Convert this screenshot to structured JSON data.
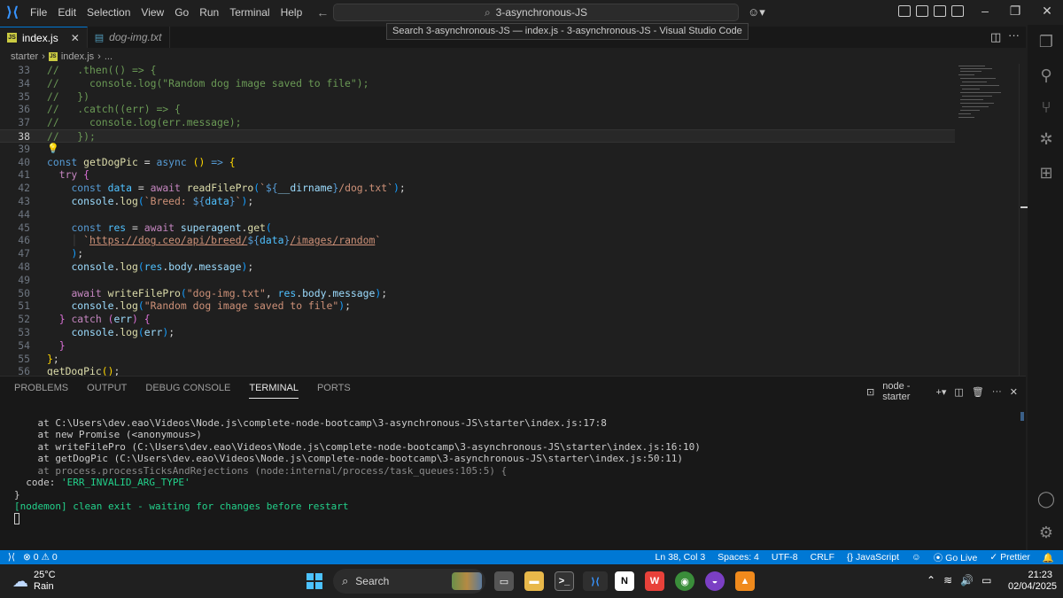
{
  "titlebar": {
    "menu": [
      "File",
      "Edit",
      "Selection",
      "View",
      "Go",
      "Run",
      "Terminal",
      "Help"
    ],
    "command_center": "3-asynchronous-JS",
    "tooltip": "Search 3-asynchronous-JS — index.js - 3-asynchronous-JS - Visual Studio Code"
  },
  "tabs": [
    {
      "label": "index.js",
      "active": true,
      "icon": "js-file-icon"
    },
    {
      "label": "dog-img.txt",
      "active": false,
      "icon": "txt-file-icon"
    }
  ],
  "breadcrumb": {
    "folder": "starter",
    "file": "index.js",
    "more": "..."
  },
  "editor": {
    "current_line": 38,
    "line_numbers": [
      "33",
      "34",
      "35",
      "36",
      "37",
      "38",
      "39",
      "40",
      "41",
      "42",
      "43",
      "44",
      "45",
      "46",
      "47",
      "48",
      "49",
      "50",
      "51",
      "52",
      "53",
      "54",
      "55",
      "56"
    ]
  },
  "panel": {
    "tabs": [
      "PROBLEMS",
      "OUTPUT",
      "DEBUG CONSOLE",
      "TERMINAL",
      "PORTS"
    ],
    "active_tab": "TERMINAL",
    "terminal_name": "node - starter",
    "lines": [
      "    at C:\\Users\\dev.eao\\Videos\\Node.js\\complete-node-bootcamp\\3-asynchronous-JS\\starter\\index.js:17:8",
      "    at new Promise (<anonymous>)",
      "    at writeFilePro (C:\\Users\\dev.eao\\Videos\\Node.js\\complete-node-bootcamp\\3-asynchronous-JS\\starter\\index.js:16:10)",
      "    at getDogPic (C:\\Users\\dev.eao\\Videos\\Node.js\\complete-node-bootcamp\\3-asynchronous-JS\\starter\\index.js:50:11)",
      "    at process.processTicksAndRejections (node:internal/process/task_queues:105:5) {",
      "  code: 'ERR_INVALID_ARG_TYPE'",
      "}",
      "[nodemon] clean exit - waiting for changes before restart"
    ]
  },
  "statusbar": {
    "errors": "0",
    "warnings": "0",
    "position": "Ln 38, Col 3",
    "spaces": "Spaces: 4",
    "encoding": "UTF-8",
    "eol": "CRLF",
    "language": "JavaScript",
    "go_live": "Go Live",
    "prettier": "Prettier"
  },
  "taskbar": {
    "temperature": "25°C",
    "weather": "Rain",
    "search_placeholder": "Search",
    "time": "21:23",
    "date": "02/04/2025"
  },
  "colors": {
    "accent": "#0078d4",
    "editor_bg": "#1f1f1f",
    "panel_bg": "#181818"
  }
}
